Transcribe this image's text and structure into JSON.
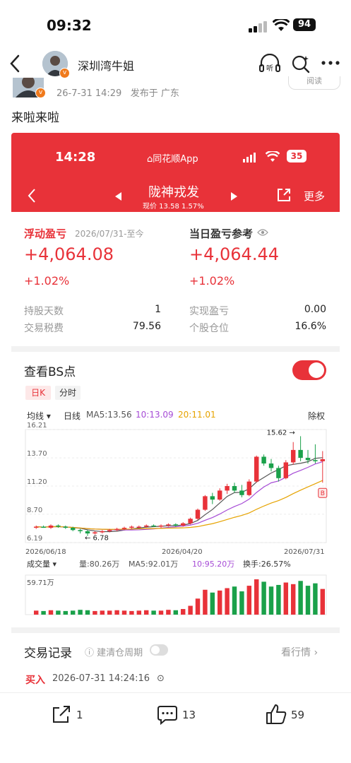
{
  "status_bar": {
    "time": "09:32",
    "battery": "94"
  },
  "nav": {
    "author": "深圳湾牛姐"
  },
  "post": {
    "meta_time": "26-7-31 14:29",
    "meta_location": "发布于 广东",
    "read_label": "阅读",
    "text": "来啦来啦"
  },
  "app": {
    "time": "14:28",
    "app_name": "同花顺App",
    "battery": "35",
    "stock_name": "陇神戎发",
    "price_line": "现价 13.58 1.57%",
    "more_label": "更多"
  },
  "pnl": {
    "float_label": "浮动盈亏",
    "float_period": "2026/07/31-至今",
    "float_value": "+4,064.08",
    "float_pct": "+1.02%",
    "daily_label": "当日盈亏参考",
    "daily_value": "+4,064.44",
    "daily_pct": "+1.02%",
    "hold_days_label": "持股天数",
    "hold_days": "1",
    "fee_label": "交易税费",
    "fee": "79.56",
    "realized_label": "实现盈亏",
    "realized": "0.00",
    "position_label": "个股仓位",
    "position": "16.6%"
  },
  "bs": {
    "title": "查看BS点",
    "tab_day": "日K",
    "tab_min": "分时",
    "indicator": "均线",
    "period": "日线",
    "ma5": "MA5:13.56",
    "ma10": "10:13.09",
    "ma20": "20:11.01",
    "adjust": "除权",
    "high_label": "15.62",
    "low_label": "6.78",
    "b_marker": "B",
    "y_ticks": [
      "16.21",
      "13.70",
      "11.20",
      "8.70",
      "6.19"
    ],
    "x_ticks": [
      "2026/06/18",
      "2026/04/20",
      "2026/07/31"
    ],
    "vol_select": "成交量",
    "vol": "量:80.26万",
    "vol_ma5": "MA5:92.01万",
    "vol_ma10": "10:95.20万",
    "turnover": "换手:26.57%",
    "vol_tick": "59.71万"
  },
  "trades": {
    "title": "交易记录",
    "cycle_label": "建清仓周期",
    "view_label": "看行情",
    "first_type": "买入",
    "first_time": "2026-07-31 14:24:16"
  },
  "bottom": {
    "share": "1",
    "comments": "13",
    "likes": "59"
  },
  "colors": {
    "red": "#e83239",
    "green": "#1aa14a",
    "purple": "#a64bd6",
    "yellow": "#e6a300"
  },
  "chart_data": {
    "type": "candlestick",
    "x_ticks": [
      "2026/06/18",
      "2026/04/20",
      "2026/07/31"
    ],
    "ylim": [
      6.19,
      16.21
    ],
    "y_ticks": [
      16.21,
      13.7,
      11.2,
      8.7,
      6.19
    ],
    "candles": [
      [
        7.6,
        7.7,
        7.4,
        7.6
      ],
      [
        7.6,
        7.7,
        7.5,
        7.5
      ],
      [
        7.5,
        7.8,
        7.4,
        7.7
      ],
      [
        7.7,
        7.8,
        7.5,
        7.6
      ],
      [
        7.6,
        7.7,
        7.4,
        7.5
      ],
      [
        7.5,
        7.6,
        7.2,
        7.3
      ],
      [
        7.3,
        7.4,
        7.0,
        7.2
      ],
      [
        7.2,
        7.3,
        6.78,
        7.0
      ],
      [
        7.0,
        7.2,
        6.9,
        7.1
      ],
      [
        7.1,
        7.3,
        7.0,
        7.2
      ],
      [
        7.2,
        7.4,
        7.1,
        7.3
      ],
      [
        7.3,
        7.5,
        7.2,
        7.4
      ],
      [
        7.4,
        7.6,
        7.3,
        7.5
      ],
      [
        7.5,
        7.7,
        7.4,
        7.6
      ],
      [
        7.6,
        7.7,
        7.5,
        7.6
      ],
      [
        7.6,
        7.8,
        7.5,
        7.7
      ],
      [
        7.7,
        7.8,
        7.6,
        7.6
      ],
      [
        7.6,
        7.8,
        7.5,
        7.7
      ],
      [
        7.7,
        7.9,
        7.6,
        7.8
      ],
      [
        7.8,
        7.9,
        7.6,
        7.7
      ],
      [
        7.7,
        8.0,
        7.6,
        7.9
      ],
      [
        7.9,
        8.4,
        7.8,
        8.3
      ],
      [
        8.3,
        9.2,
        8.2,
        9.1
      ],
      [
        9.1,
        10.4,
        9.0,
        10.3
      ],
      [
        10.3,
        10.6,
        9.6,
        10.0
      ],
      [
        10.0,
        11.0,
        9.9,
        10.8
      ],
      [
        10.8,
        11.4,
        10.5,
        11.2
      ],
      [
        11.2,
        11.5,
        10.6,
        10.8
      ],
      [
        10.8,
        11.3,
        10.2,
        10.4
      ],
      [
        10.4,
        11.8,
        10.3,
        11.6
      ],
      [
        11.6,
        13.9,
        11.5,
        13.8
      ],
      [
        13.8,
        14.0,
        13.0,
        13.2
      ],
      [
        13.2,
        13.6,
        12.5,
        12.8
      ],
      [
        12.8,
        13.0,
        11.6,
        11.9
      ],
      [
        11.9,
        13.5,
        11.8,
        13.3
      ],
      [
        13.3,
        15.1,
        13.1,
        14.4
      ],
      [
        14.4,
        15.62,
        13.4,
        13.7
      ],
      [
        13.7,
        14.4,
        13.2,
        13.5
      ],
      [
        13.5,
        14.9,
        13.2,
        13.4
      ],
      [
        13.4,
        14.3,
        11.5,
        13.58
      ]
    ],
    "volume": [
      10,
      9,
      11,
      10,
      9,
      10,
      12,
      11,
      9,
      10,
      10,
      11,
      10,
      9,
      10,
      11,
      10,
      10,
      12,
      11,
      14,
      22,
      40,
      62,
      55,
      60,
      66,
      70,
      58,
      72,
      88,
      82,
      70,
      74,
      80,
      76,
      84,
      72,
      78,
      64
    ],
    "vol_tick": "59.71万",
    "ma_colors": {
      "ma5": "#555555",
      "ma10": "#a64bd6",
      "ma20": "#e6a300"
    }
  }
}
